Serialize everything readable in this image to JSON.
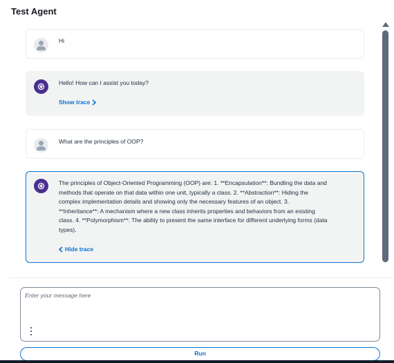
{
  "header": {
    "title": "Test Agent"
  },
  "messages": [
    {
      "role": "user",
      "text": "Hi"
    },
    {
      "role": "agent",
      "text": "Hello! How can I assist you today?",
      "trace_label": "Show trace"
    },
    {
      "role": "user",
      "text": "What are the principles of OOP?"
    },
    {
      "role": "agent",
      "text": "The principles of Object-Oriented Programming (OOP) are: 1. **Encapsulation**: Bundling the data and methods that operate on that data within one unit, typically a class. 2. **Abstraction**: Hiding the complex implementation details and showing only the necessary features of an object. 3. **Inheritance**: A mechanism where a new class inherits properties and behaviors from an existing class. 4. **Polymorphism**: The ability to present the same interface for different underlying forms (data types).",
      "trace_label": "Hide trace"
    }
  ],
  "composer": {
    "placeholder": "Enter your message here",
    "value": "",
    "run_label": "Run"
  },
  "colors": {
    "accent": "#0972d3",
    "agent_avatar": "#4a2f8f",
    "agent_bubble": "#f2f3f3"
  },
  "icons": {
    "user_avatar": "user-icon",
    "agent_avatar": "brain-icon",
    "more": "vertical-dots-icon"
  }
}
